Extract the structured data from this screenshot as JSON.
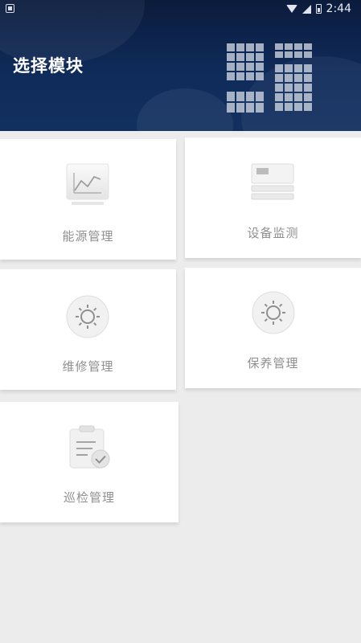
{
  "status_bar": {
    "time": "2:44"
  },
  "header": {
    "title": "选择模块"
  },
  "modules": [
    {
      "label": "能源管理",
      "icon": "energy-chart-icon"
    },
    {
      "label": "设备监测",
      "icon": "device-monitor-icon"
    },
    {
      "label": "维修管理",
      "icon": "repair-gear-icon"
    },
    {
      "label": "保养管理",
      "icon": "maintenance-gear-icon"
    },
    {
      "label": "巡检管理",
      "icon": "inspection-clipboard-icon"
    }
  ],
  "colors": {
    "header_dark": "#0b1b3c",
    "header_light": "#12305f",
    "background": "#ececec",
    "card": "#ffffff",
    "label": "#8f8f8f"
  }
}
